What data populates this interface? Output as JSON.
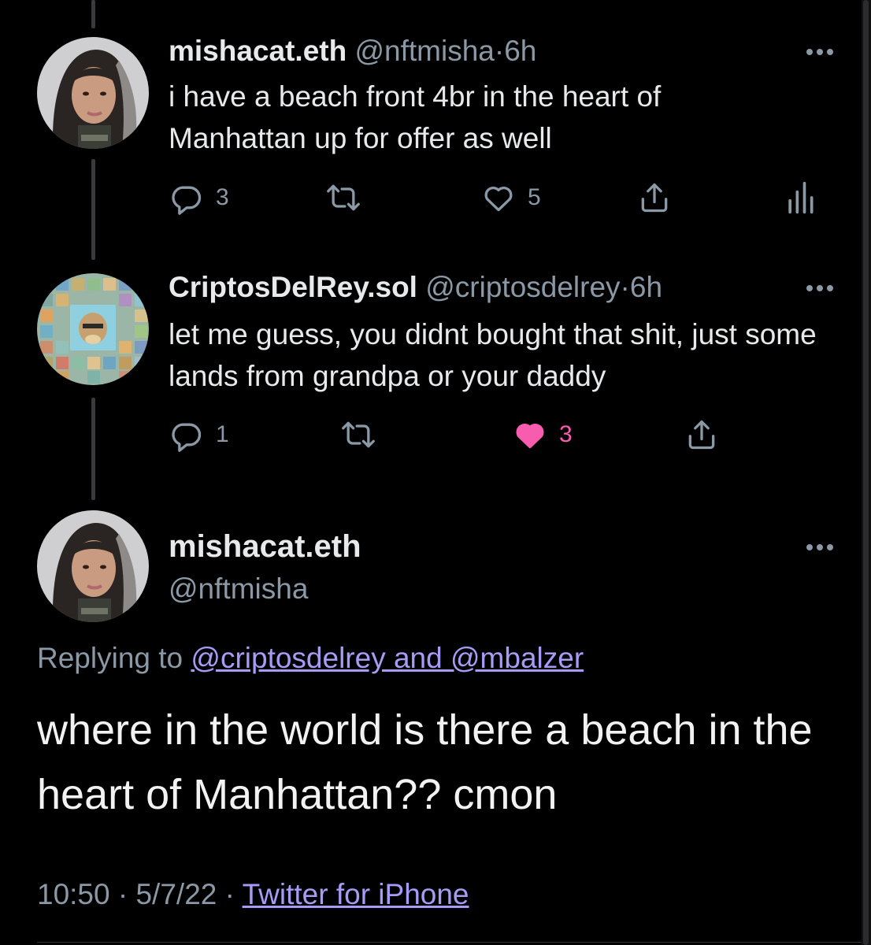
{
  "tweets": [
    {
      "name": "mishacat.eth",
      "handle": "@nftmisha",
      "time": "6h",
      "text": "i have a beach front 4br in the heart of Manhattan up for offer as well",
      "replies": "3",
      "likes": "5",
      "liked": false
    },
    {
      "name": "CriptosDelRey.sol",
      "handle": "@criptosdelrey",
      "time": "6h",
      "text": "let me guess, you didnt bought that shit, just some lands from grandpa or your daddy",
      "replies": "1",
      "likes": "3",
      "liked": true
    }
  ],
  "main_tweet": {
    "name": "mishacat.eth",
    "handle": "@nftmisha",
    "replying_prefix": "Replying to",
    "replying_to": "@criptosdelrey and @mbalzer",
    "text": "where in the world is there a beach in the heart of Manhattan?? cmon",
    "time": "10:50",
    "date": "5/7/22",
    "source": "Twitter for iPhone"
  },
  "separator": "·",
  "colors": {
    "background": "#000000",
    "text": "#e7e9ea",
    "muted": "#8b98a5",
    "link": "#a79cf5",
    "like_active": "#f91880"
  },
  "icons": [
    "reply-icon",
    "retweet-icon",
    "like-icon",
    "share-icon",
    "analytics-icon",
    "more-icon"
  ]
}
